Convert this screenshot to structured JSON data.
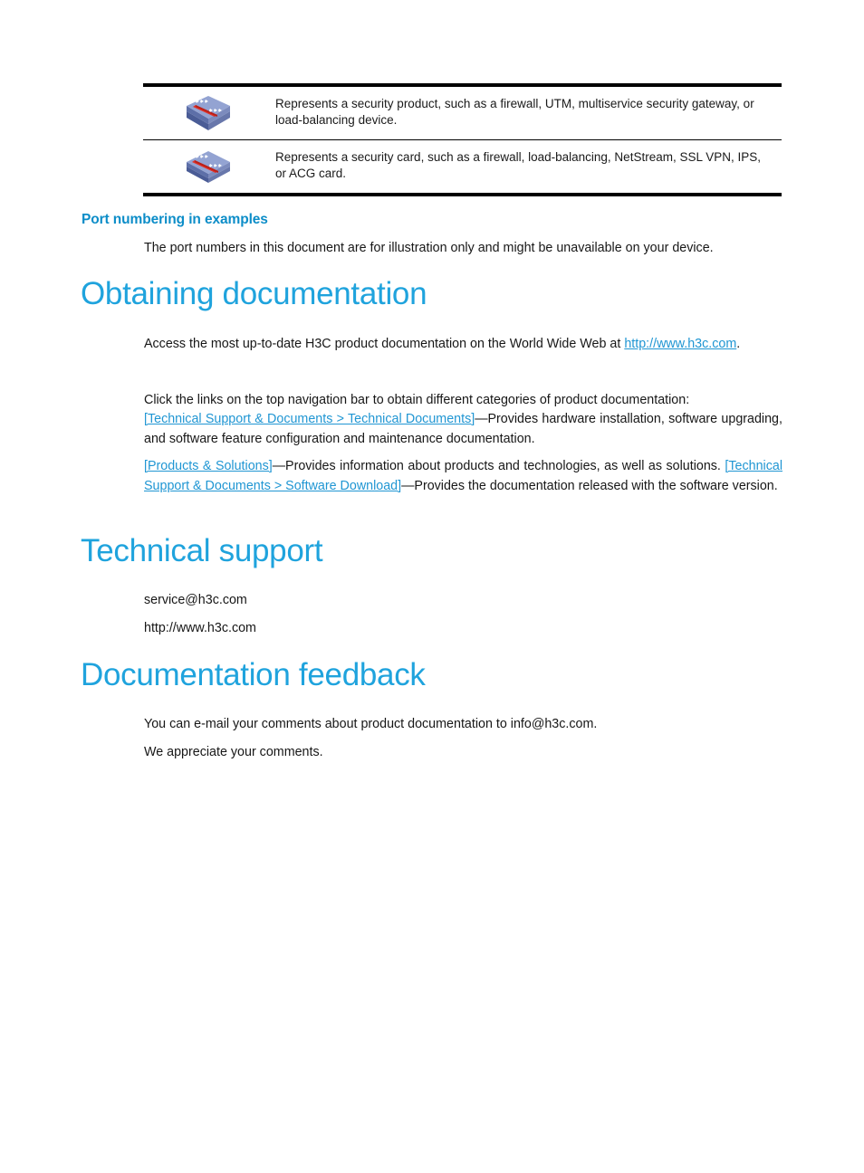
{
  "legend_table": {
    "rows": [
      {
        "icon": "security-product-icon",
        "description": "Represents a security product, such as a firewall, UTM, multiservice security gateway, or load-balancing device."
      },
      {
        "icon": "security-card-icon",
        "description": "Represents a security card, such as a firewall, load-balancing, NetStream, SSL VPN, IPS, or ACG card."
      }
    ]
  },
  "sections": {
    "port_numbering": {
      "heading": "Port numbering in examples",
      "body": "The port numbers in this document are for illustration only and might be unavailable on your device."
    },
    "obtaining_documentation": {
      "heading": "Obtaining documentation",
      "p1_before_link": "Access the most up-to-date H3C product documentation on the World Wide Web at ",
      "p1_link": "http://www.h3c.com",
      "p1_after_link": ".",
      "p2": "Click the links on the top navigation bar to obtain different categories of product documentation:",
      "p3_link": "[Technical Support & Documents > Technical Documents]",
      "p3_after_link": "—Provides hardware installation, software upgrading, and software feature configuration and maintenance documentation.",
      "p4_link1": "[Products & Solutions]",
      "p4_mid": "—Provides information about products and technologies, as well as solutions. ",
      "p4_link2": "[Technical Support & Documents > Software Download]",
      "p4_after": "—Provides the documentation released with the software version."
    },
    "technical_support": {
      "heading": "Technical support",
      "email": "service@h3c.com",
      "website": "http://www.h3c.com"
    },
    "documentation_feedback": {
      "heading": "Documentation feedback",
      "p1": "You can e-mail your comments about product documentation to info@h3c.com.",
      "p2": "We appreciate your comments."
    }
  },
  "colors": {
    "heading_blue": "#1fa3dd",
    "subheading_blue": "#0c8dc8",
    "link_blue": "#2096d3",
    "icon_box_top": "#8e9fcf",
    "icon_box_front": "#5d6fa8",
    "icon_accent_red": "#e03127",
    "rule_black": "#000000"
  }
}
